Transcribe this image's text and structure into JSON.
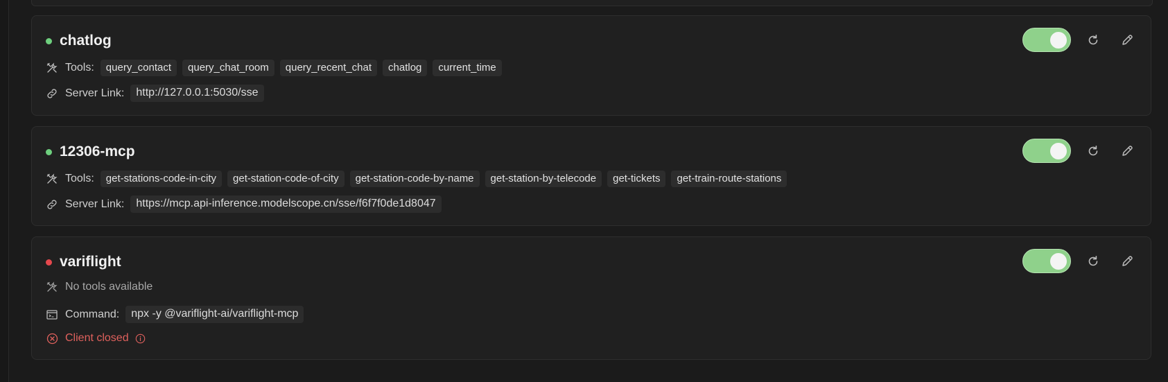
{
  "labels": {
    "tools": "Tools:",
    "server_link": "Server Link:",
    "command": "Command:"
  },
  "colors": {
    "status_ok": "#6ecf7e",
    "status_error": "#e5484d",
    "toggle_on": "#8fd18b",
    "error_text": "#e0615d"
  },
  "servers": [
    {
      "name": "chatlog",
      "status": "ok",
      "enabled": true,
      "tools": [
        "query_contact",
        "query_chat_room",
        "query_recent_chat",
        "chatlog",
        "current_time"
      ],
      "server_link": "http://127.0.0.1:5030/sse"
    },
    {
      "name": "12306-mcp",
      "status": "ok",
      "enabled": true,
      "tools": [
        "get-stations-code-in-city",
        "get-station-code-of-city",
        "get-station-code-by-name",
        "get-station-by-telecode",
        "get-tickets",
        "get-train-route-stations"
      ],
      "server_link": "https://mcp.api-inference.modelscope.cn/sse/f6f7f0de1d8047"
    },
    {
      "name": "variflight",
      "status": "error",
      "enabled": true,
      "no_tools_text": "No tools available",
      "command": "npx -y @variflight-ai/variflight-mcp",
      "error_text": "Client closed"
    }
  ],
  "icons": {
    "tools": "tools-icon",
    "link": "link-icon",
    "command": "terminal-icon",
    "refresh": "refresh-icon",
    "edit": "edit-icon",
    "error": "error-circle-icon",
    "info": "info-icon"
  }
}
